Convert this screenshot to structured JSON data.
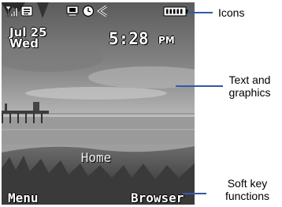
{
  "phone": {
    "status_icons": [
      "signal-bars-icon",
      "message-icon",
      "voicemail-icon",
      "alarm-clock-icon",
      "speaker-icon",
      "battery-icon"
    ],
    "date": {
      "day": "Jul 25",
      "weekday": "Wed"
    },
    "time": {
      "value": "5:28",
      "ampm": "PM"
    },
    "screen_label": "Home",
    "softkeys": {
      "left": "Menu",
      "right": "Browser"
    }
  },
  "callouts": {
    "icons": "Icons",
    "text_graphics_line1": "Text and",
    "text_graphics_line2": "graphics",
    "softkey_line1": "Soft key",
    "softkey_line2": "functions"
  },
  "colors": {
    "leader": "#3459a8"
  }
}
